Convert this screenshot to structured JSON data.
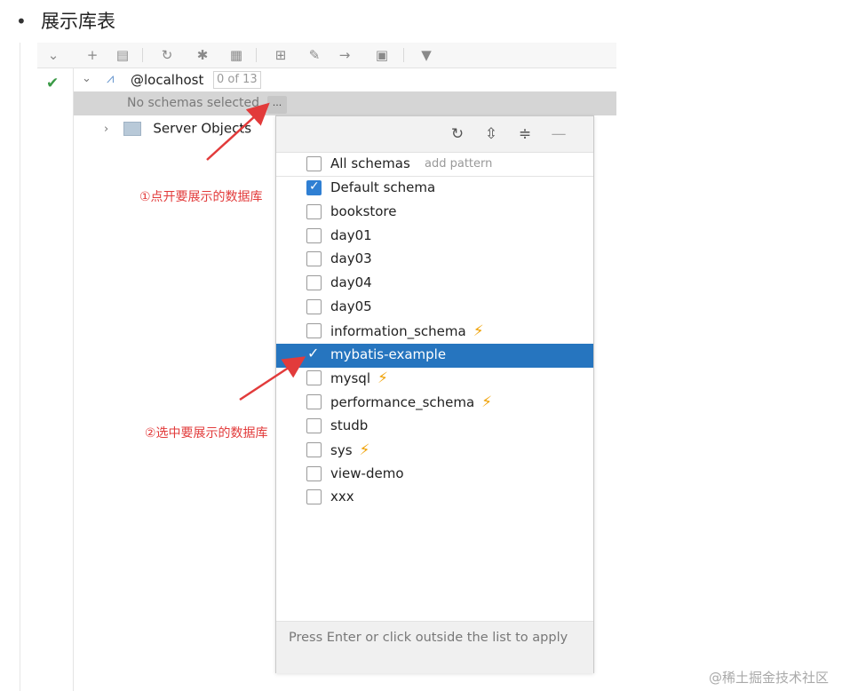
{
  "article": {
    "bullet": "•",
    "heading": "展示库表"
  },
  "ide": {
    "tree": {
      "host_label": "@localhost",
      "schema_count": "0 of 13",
      "no_schemas_text": "No schemas selected",
      "ellipsis_button": "...",
      "server_objects_label": "Server Objects"
    },
    "popup": {
      "all_schemas_label": "All schemas",
      "add_pattern_link": "add pattern",
      "items": [
        {
          "label": "Default schema",
          "checked": true,
          "bolt": false,
          "highlight": false
        },
        {
          "label": "bookstore",
          "checked": false,
          "bolt": false,
          "highlight": false
        },
        {
          "label": "day01",
          "checked": false,
          "bolt": false,
          "highlight": false
        },
        {
          "label": "day03",
          "checked": false,
          "bolt": false,
          "highlight": false
        },
        {
          "label": "day04",
          "checked": false,
          "bolt": false,
          "highlight": false
        },
        {
          "label": "day05",
          "checked": false,
          "bolt": false,
          "highlight": false
        },
        {
          "label": "information_schema",
          "checked": false,
          "bolt": true,
          "highlight": false
        },
        {
          "label": "mybatis-example",
          "checked": true,
          "bolt": false,
          "highlight": true
        },
        {
          "label": "mysql",
          "checked": false,
          "bolt": true,
          "highlight": false
        },
        {
          "label": "performance_schema",
          "checked": false,
          "bolt": true,
          "highlight": false
        },
        {
          "label": "studb",
          "checked": false,
          "bolt": false,
          "highlight": false
        },
        {
          "label": "sys",
          "checked": false,
          "bolt": true,
          "highlight": false
        },
        {
          "label": "view-demo",
          "checked": false,
          "bolt": false,
          "highlight": false
        },
        {
          "label": "xxx",
          "checked": false,
          "bolt": false,
          "highlight": false
        }
      ],
      "footer_text": "Press Enter or click outside the list to apply"
    }
  },
  "annotations": {
    "step1": "①点开要展示的数据库",
    "step2": "②选中要展示的数据库"
  },
  "watermark": "@稀土掘金技术社区",
  "colors": {
    "highlight": "#2675bf",
    "checkbox_checked": "#2f7fd3",
    "bolt": "#f0a30a",
    "annotation": "#e23b3b",
    "status_ok": "#3a9a46"
  }
}
